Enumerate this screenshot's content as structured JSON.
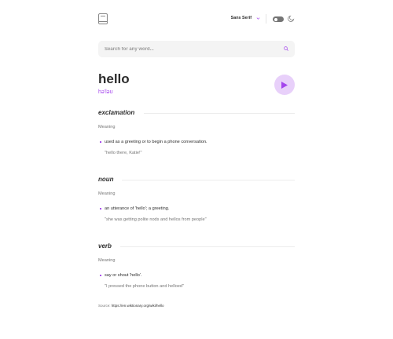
{
  "header": {
    "logo_icon": "book-icon",
    "font_label": "Sans Serif",
    "font_chevron_icon": "chevron-down-icon",
    "theme_toggle": {
      "state": "off"
    },
    "theme_icon": "moon-icon"
  },
  "search": {
    "value": "",
    "placeholder": "Search for any word...",
    "icon": "search-icon"
  },
  "entry": {
    "word": "hello",
    "phonetic": "hə'ləʊ",
    "play_icon": "play-icon",
    "accent_color": "#a445ed"
  },
  "meanings": [
    {
      "part_of_speech": "exclamation",
      "label": "Meaning",
      "definition": "used as a greeting or to begin a phone conversation.",
      "example": "\"hello there, Katie!\""
    },
    {
      "part_of_speech": "noun",
      "label": "Meaning",
      "definition": "an utterance of 'hello'; a greeting.",
      "example": "\"she was getting polite nods and hellos from people\""
    },
    {
      "part_of_speech": "verb",
      "label": "Meaning",
      "definition": "say or shout 'hello'.",
      "example": "\"I pressed the phone button and helloed\""
    }
  ],
  "source": {
    "label": "Source",
    "url": "https://en.wiktionary.org/wiki/hello"
  }
}
